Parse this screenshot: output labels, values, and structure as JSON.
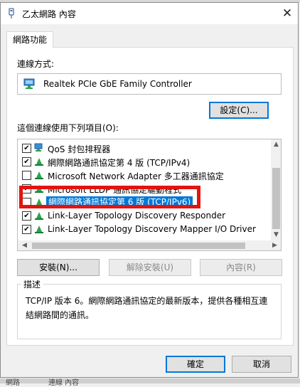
{
  "dialog": {
    "title": "乙太網路 內容",
    "close_glyph": "✕",
    "tab_label": "網路功能",
    "connect_using_label": "連線方式:",
    "adapter_name": "Realtek PCIe GbE Family Controller",
    "configure_button": "設定(C)...",
    "items_label": "這個連線使用下列項目(O):",
    "items": [
      {
        "label": "QoS 封包排程器",
        "checked": true,
        "icon": "network-service-icon"
      },
      {
        "label": "網際網路通訊協定第 4 版 (TCP/IPv4)",
        "checked": true,
        "icon": "protocol-icon"
      },
      {
        "label": "Microsoft Network Adapter 多工器通訊協定",
        "checked": false,
        "icon": "protocol-icon"
      },
      {
        "label": "Microsoft LLDP 通訊協定驅動程式",
        "checked": true,
        "icon": "protocol-icon"
      },
      {
        "label": "網際網路通訊協定第 6 版 (TCP/IPv6)",
        "checked": false,
        "icon": "protocol-icon",
        "selected": true
      },
      {
        "label": "Link-Layer Topology Discovery Responder",
        "checked": true,
        "icon": "protocol-icon"
      },
      {
        "label": "Link-Layer Topology Discovery Mapper I/O Driver",
        "checked": true,
        "icon": "protocol-icon"
      }
    ],
    "install_button": "安裝(N)...",
    "uninstall_button": "解除安裝(U)",
    "properties_button": "內容(R)",
    "description_legend": "描述",
    "description_text": "TCP/IP 版本 6。網際網路通訊協定的最新版本，提供各種相互連結網路間的通訊。",
    "ok_button": "確定",
    "cancel_button": "取消"
  },
  "background": {
    "bottom_text_left": "網路",
    "bottom_text_mid": "連線 內容"
  },
  "colors": {
    "accent": "#0078d7",
    "highlight_box": "#e3140f",
    "checkbox_mark": "#000000"
  }
}
